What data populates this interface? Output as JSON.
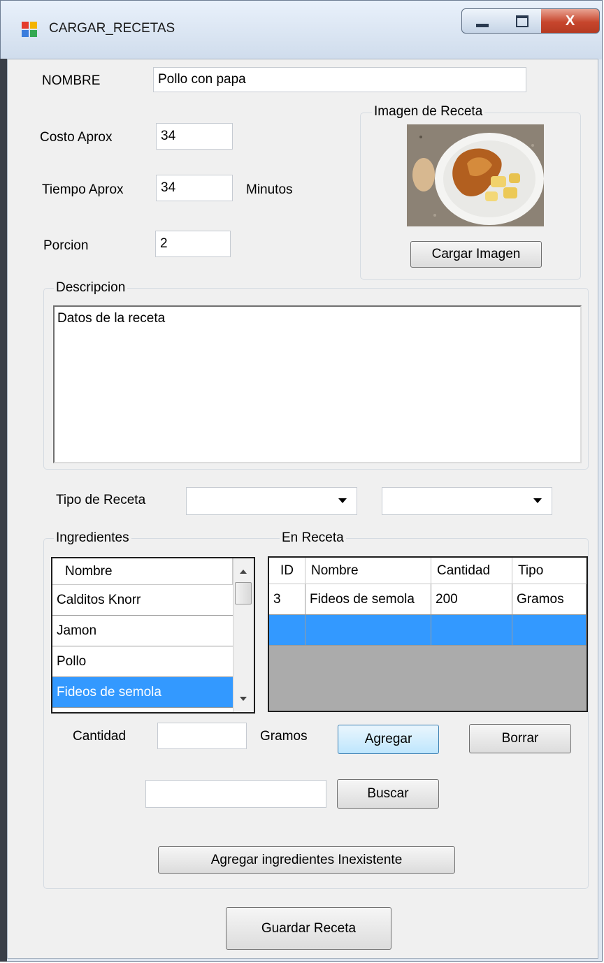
{
  "window": {
    "title": "CARGAR_RECETAS",
    "minimize_icon": "minimize-icon",
    "maximize_icon": "maximize-icon",
    "close_glyph": "X"
  },
  "form": {
    "nombre_label": "NOMBRE",
    "nombre_value": "Pollo con papa",
    "costo_label": "Costo Aprox",
    "costo_value": "34",
    "tiempo_label": "Tiempo Aprox",
    "tiempo_value": "34",
    "tiempo_unit": "Minutos",
    "porcion_label": "Porcion",
    "porcion_value": "2"
  },
  "imagen": {
    "group_label": "Imagen de Receta",
    "button_label": "Cargar Imagen"
  },
  "descripcion": {
    "group_label": "Descripcion",
    "value": "Datos de la receta"
  },
  "tipo": {
    "label": "Tipo de Receta",
    "combo1_value": "",
    "combo2_value": ""
  },
  "ingredientes": {
    "group_label": "Ingredientes",
    "header": "Nombre",
    "items": [
      "Calditos Knorr",
      "Jamon",
      "Pollo",
      "Fideos de semola"
    ],
    "selected_index": 3
  },
  "en_receta": {
    "group_label": "En Receta",
    "columns": [
      "ID",
      "Nombre",
      "Cantidad",
      "Tipo"
    ],
    "rows": [
      [
        "3",
        "Fideos de semola",
        "200",
        "Gramos"
      ],
      [
        "",
        "",
        "",
        ""
      ]
    ]
  },
  "cantidad": {
    "label": "Cantidad",
    "value": "",
    "unit": "Gramos",
    "agregar_label": "Agregar",
    "borrar_label": "Borrar"
  },
  "buscar": {
    "value": "",
    "button_label": "Buscar"
  },
  "agregar_inexistente_label": "Agregar ingredientes Inexistente",
  "guardar_label": "Guardar Receta"
}
